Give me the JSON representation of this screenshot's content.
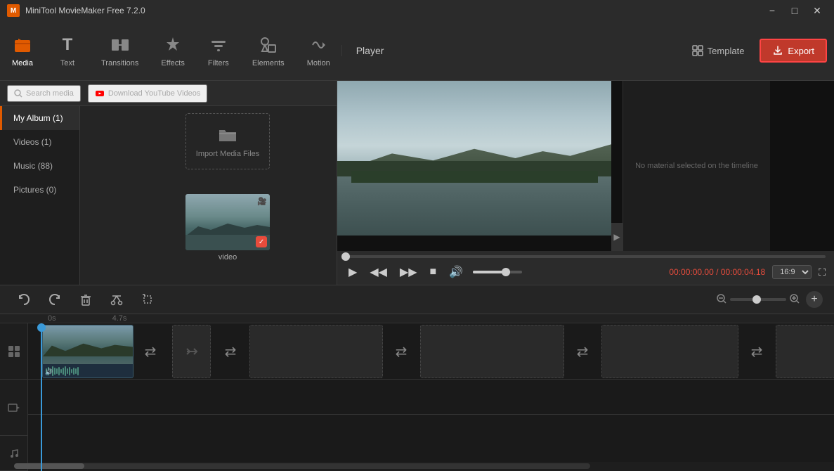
{
  "titlebar": {
    "app_name": "MiniTool MovieMaker Free 7.2.0",
    "minimize_label": "−",
    "maximize_label": "□",
    "close_label": "✕"
  },
  "toolbar": {
    "items": [
      {
        "id": "media",
        "label": "Media",
        "icon": "📁",
        "active": true
      },
      {
        "id": "text",
        "label": "Text",
        "icon": "T",
        "active": false
      },
      {
        "id": "transitions",
        "label": "Transitions",
        "icon": "⟷",
        "active": false
      },
      {
        "id": "effects",
        "label": "Effects",
        "icon": "✦",
        "active": false
      },
      {
        "id": "filters",
        "label": "Filters",
        "icon": "⧈",
        "active": false
      },
      {
        "id": "elements",
        "label": "Elements",
        "icon": "◈",
        "active": false
      },
      {
        "id": "motion",
        "label": "Motion",
        "icon": "➤",
        "active": false
      }
    ],
    "template_label": "Template",
    "export_label": "Export",
    "player_label": "Player"
  },
  "media_panel": {
    "search_label": "Search media",
    "download_label": "Download YouTube Videos",
    "sidebar": [
      {
        "id": "my_album",
        "label": "My Album (1)",
        "active": true
      },
      {
        "id": "videos",
        "label": "Videos (1)",
        "active": false
      },
      {
        "id": "music",
        "label": "Music (88)",
        "active": false
      },
      {
        "id": "pictures",
        "label": "Pictures (0)",
        "active": false
      }
    ],
    "import_label": "Import Media Files",
    "video_item_label": "video"
  },
  "player": {
    "label": "Player",
    "current_time": "00:00:00.00",
    "total_time": "00:00:04.18",
    "time_separator": " / ",
    "aspect_ratio": "16:9",
    "no_material_text": "No material selected on the timeline"
  },
  "edit_toolbar": {
    "undo_label": "undo",
    "redo_label": "redo",
    "delete_label": "delete",
    "cut_label": "cut",
    "crop_label": "crop"
  },
  "timeline": {
    "time_markers": [
      "0s",
      "4.7s"
    ],
    "add_label": "+",
    "zoom_label": "zoom"
  },
  "colors": {
    "accent": "#e05a00",
    "red": "#c0392b",
    "border_red": "#ff4444",
    "progress": "#e74c3c",
    "playhead": "#3a9ad9",
    "wave": "#4a8a7a"
  }
}
